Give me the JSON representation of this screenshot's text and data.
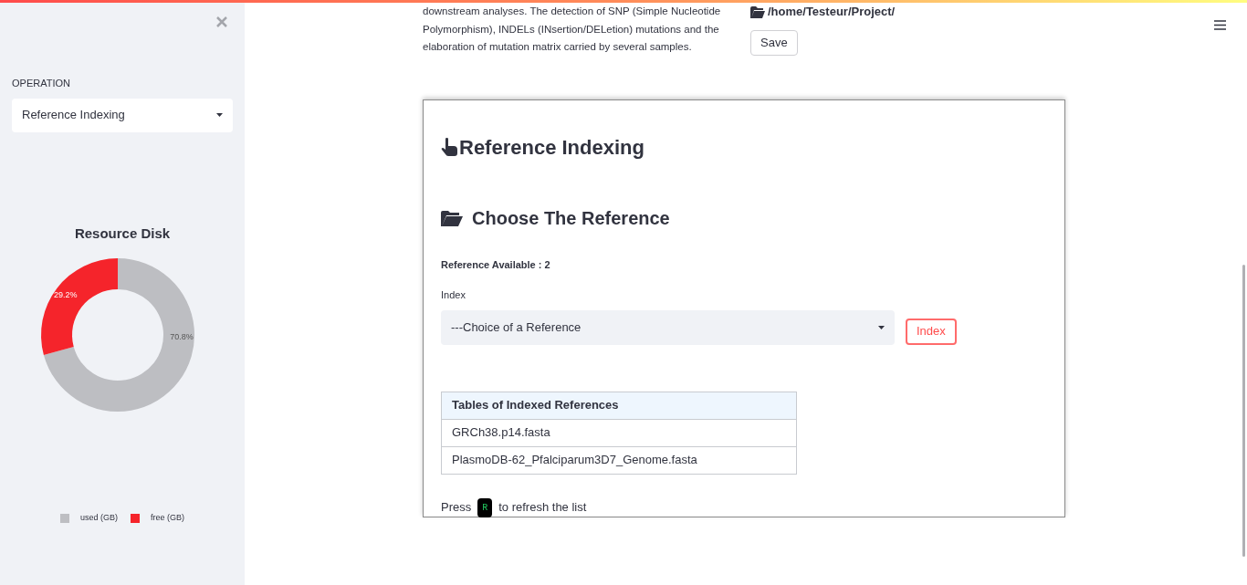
{
  "sidebar": {
    "operation_label": "OPERATION",
    "operation_value": "Reference Indexing",
    "chart_data": {
      "type": "donut",
      "title": "Resource Disk",
      "legend": true,
      "categories": [
        "used (GB)",
        "free (GB)"
      ],
      "series": [
        {
          "values": [
            70.8,
            29.2
          ]
        }
      ],
      "colors": [
        "#bdbec2",
        "#f5242b"
      ],
      "value_labels": [
        "70.8%",
        "29.2%"
      ]
    }
  },
  "intro": {
    "lines": [
      "downstream analyses. The detection of SNP (Simple Nucleotide",
      "Polymorphism), INDELs (INsertion/DELetion) mutations and the",
      "elaboration of mutation matrix carried by several samples."
    ],
    "path": "/home/Testeur/Project/",
    "save_button": "Save"
  },
  "card": {
    "title": "Reference Indexing",
    "section_title": "Choose The Reference",
    "available": "Reference Available : 2",
    "select_label": "Index",
    "select_value": "---Choice of a Reference",
    "index_button": "Index",
    "table": {
      "columns": [
        "Tables of Indexed References"
      ],
      "rows": [
        [
          "GRCh38.p14.fasta"
        ],
        [
          "PlasmoDB-62_Pfalciparum3D7_Genome.fasta"
        ]
      ]
    },
    "hint": [
      "Press",
      "R",
      "to refresh the list"
    ]
  }
}
